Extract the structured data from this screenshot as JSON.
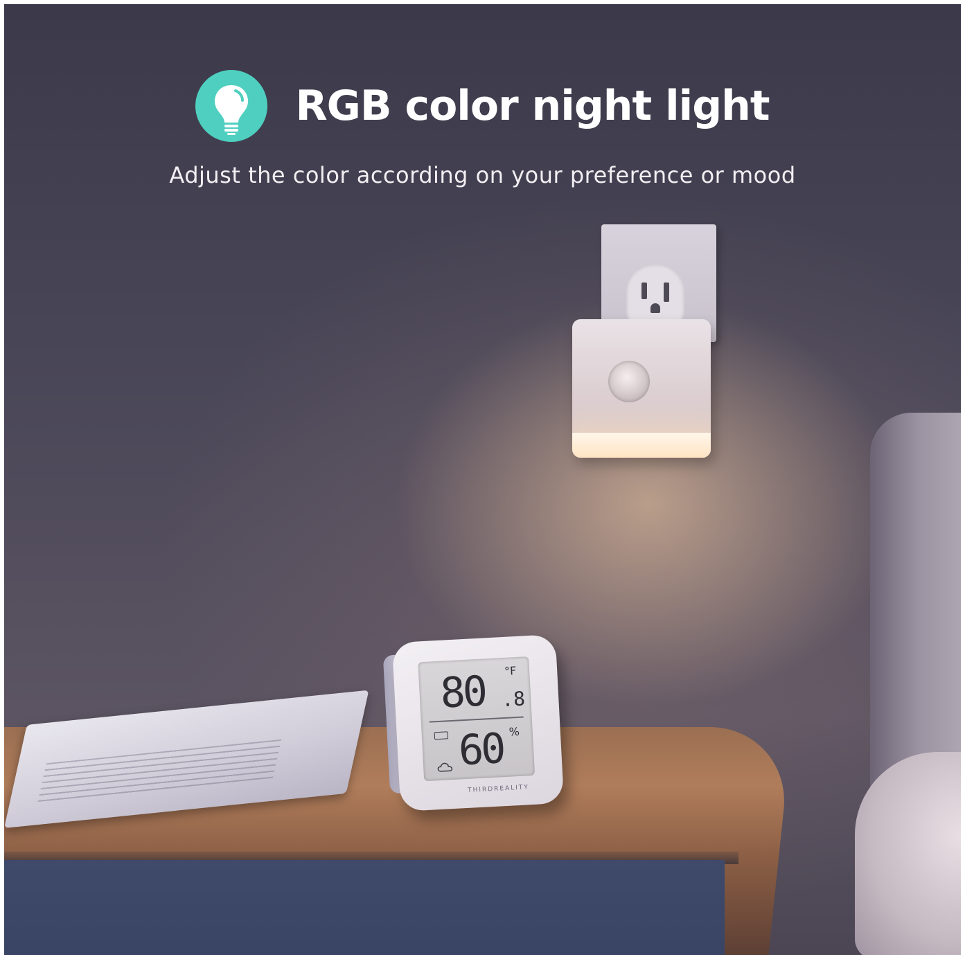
{
  "headline": {
    "icon": "lightbulb-icon",
    "title": "RGB color night light"
  },
  "subtitle": "Adjust the color according on your preference or mood",
  "thermometer": {
    "temperature": "80",
    "temperature_decimal": ".8",
    "temperature_unit": "°F",
    "humidity": "60",
    "humidity_unit": "%",
    "brand": "THIRDREALITY"
  },
  "colors": {
    "accent_badge": "#4fcfc0",
    "title_text": "#ffffff"
  }
}
